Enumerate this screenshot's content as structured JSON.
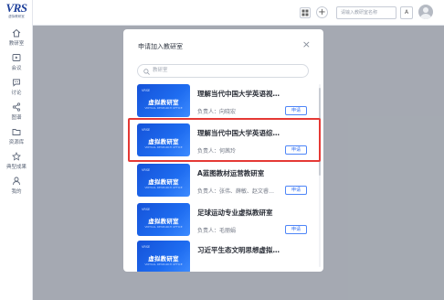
{
  "sidebar": {
    "logo_text": "VRS",
    "logo_sub": "虚拟教研室",
    "items": [
      {
        "icon": "home-icon",
        "label": "教研室"
      },
      {
        "icon": "meeting-icon",
        "label": "会议"
      },
      {
        "icon": "discussion-icon",
        "label": "讨论"
      },
      {
        "icon": "graph-icon",
        "label": "图谱"
      },
      {
        "icon": "resource-icon",
        "label": "资源库"
      },
      {
        "icon": "achievement-icon",
        "label": "典型成果"
      },
      {
        "icon": "user-icon",
        "label": "我的"
      }
    ]
  },
  "topbar": {
    "search_placeholder": "请输入教研室名称",
    "plus_label": "+",
    "translate_label": "A",
    "icons": [
      "grid-icon",
      "plus-icon",
      "translate-icon",
      "avatar"
    ]
  },
  "modal": {
    "title": "申请加入教研室",
    "close": "×",
    "search_placeholder": "教研室",
    "items": [
      {
        "title": "理解当代中国大学英语视…",
        "owner": "负责人：向晓宏",
        "button": "申请",
        "thumb_tag": "VRSE",
        "thumb_name": "虚拟教研室",
        "thumb_sub": "VIRTUAL RESEARCH OFFICE"
      },
      {
        "title": "理解当代中国大学英语综…",
        "owner": "负责人：何茜玲",
        "button": "申请",
        "thumb_tag": "VRSE",
        "thumb_name": "虚拟教研室",
        "thumb_sub": "VIRTUAL RESEARCH OFFICE"
      },
      {
        "title": "A蓝图教材运营教研室",
        "owner": "负责人：张伟、薛敏、赵文睿…",
        "button": "申请",
        "thumb_tag": "VRSE",
        "thumb_name": "虚拟教研室",
        "thumb_sub": "VIRTUAL RESEARCH OFFICE"
      },
      {
        "title": "足球运动专业虚拟教研室",
        "owner": "负责人：毛丽娟",
        "button": "申请",
        "thumb_tag": "VRSE",
        "thumb_name": "虚拟教研室",
        "thumb_sub": "VIRTUAL RESEARCH OFFICE"
      },
      {
        "title": "习近平生态文明思想虚拟…",
        "owner": "",
        "button": "",
        "thumb_tag": "VRSE",
        "thumb_name": "虚拟教研室",
        "thumb_sub": "VIRTUAL RESEARCH OFFICE"
      }
    ]
  },
  "colors": {
    "accent": "#2f6ef2",
    "highlight": "#e53935",
    "brand": "#1d3f9a"
  }
}
